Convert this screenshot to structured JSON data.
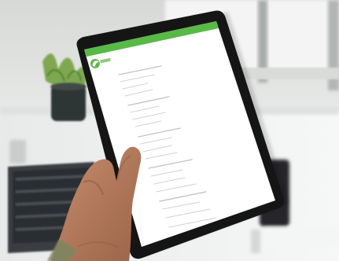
{
  "scene": {
    "subject": "hand-holding-tablet",
    "tablet_app_logo_icon": "green-leaf-logo-icon",
    "colors": {
      "accent": "#58b947",
      "tablet_bezel": "#151515",
      "tablet_screen": "#ffffff",
      "desk_surface": "#e8e9e9",
      "keyboard": "#3a3d42",
      "plant_leaves": "#7aa449",
      "plant_pot": "#2f3436"
    }
  }
}
